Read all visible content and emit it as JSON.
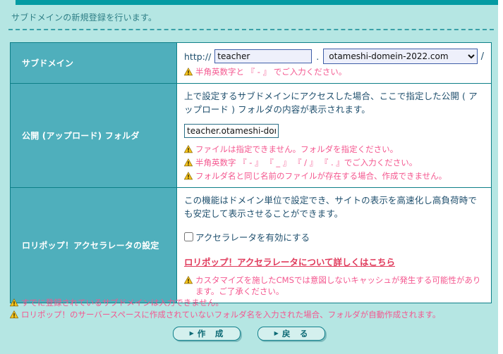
{
  "page": {
    "intro_text": "サブドメインの新規登録を行います。",
    "accent_color": "#049ba3",
    "label_bg_color": "#4fafbc",
    "warn_color": "#f4578f",
    "link_color": "#e03b5c"
  },
  "rows": [
    {
      "label": "サブドメイン",
      "protocol": "http://",
      "subdomain_value": "teacher",
      "subdomain_placeholder": "",
      "separator": ".",
      "domain_selected": "otameshi-domein-2022.com",
      "domain_options": [
        "otameshi-domein-2022.com"
      ],
      "trailing_slash": "/",
      "warnings": [
        "半角英数字と 『 - 』 でご入力ください。"
      ]
    },
    {
      "label": "公開 (アップロード) フォルダ",
      "description": "上で設定するサブドメインにアクセスした場合、ここで指定した公開 ( アップロード ) フォルダの内容が表示されます。",
      "folder_value": "teacher.otameshi-dome",
      "folder_placeholder": "",
      "warnings": [
        "ファイルは指定できません。フォルダを指定ください。",
        "半角英数字 『 - 』 『 _ 』 『 / 』 『 . 』でご入力ください。",
        "フォルダ名と同じ名前のファイルが存在する場合、作成できません。"
      ]
    },
    {
      "label": "ロリポップ！アクセラレータの設定",
      "description": "この機能はドメイン単位で設定でき、サイトの表示を高速化し高負荷時でも安定して表示させることができます。",
      "checkbox_label": "アクセラレータを有効にする",
      "checkbox_checked": false,
      "link_text": "ロリポップ！アクセラレータについて詳しくはこちら",
      "warnings": [
        "カスタマイズを施したCMSでは意図しないキャッシュが発生する可能性があります。ご了承ください。"
      ]
    }
  ],
  "footnotes": [
    "すでに登録されているサブドメインは入力できません。",
    "ロリポップ！のサーバースペースに作成されていないフォルダ名を入力された場合、フォルダが自動作成されます。"
  ],
  "buttons": {
    "submit_label": "作　成",
    "back_label": "戻　る",
    "marker": "▶"
  },
  "icons": {
    "warning": "warning-triangle-icon",
    "dropdown": "chevron-down-icon"
  }
}
